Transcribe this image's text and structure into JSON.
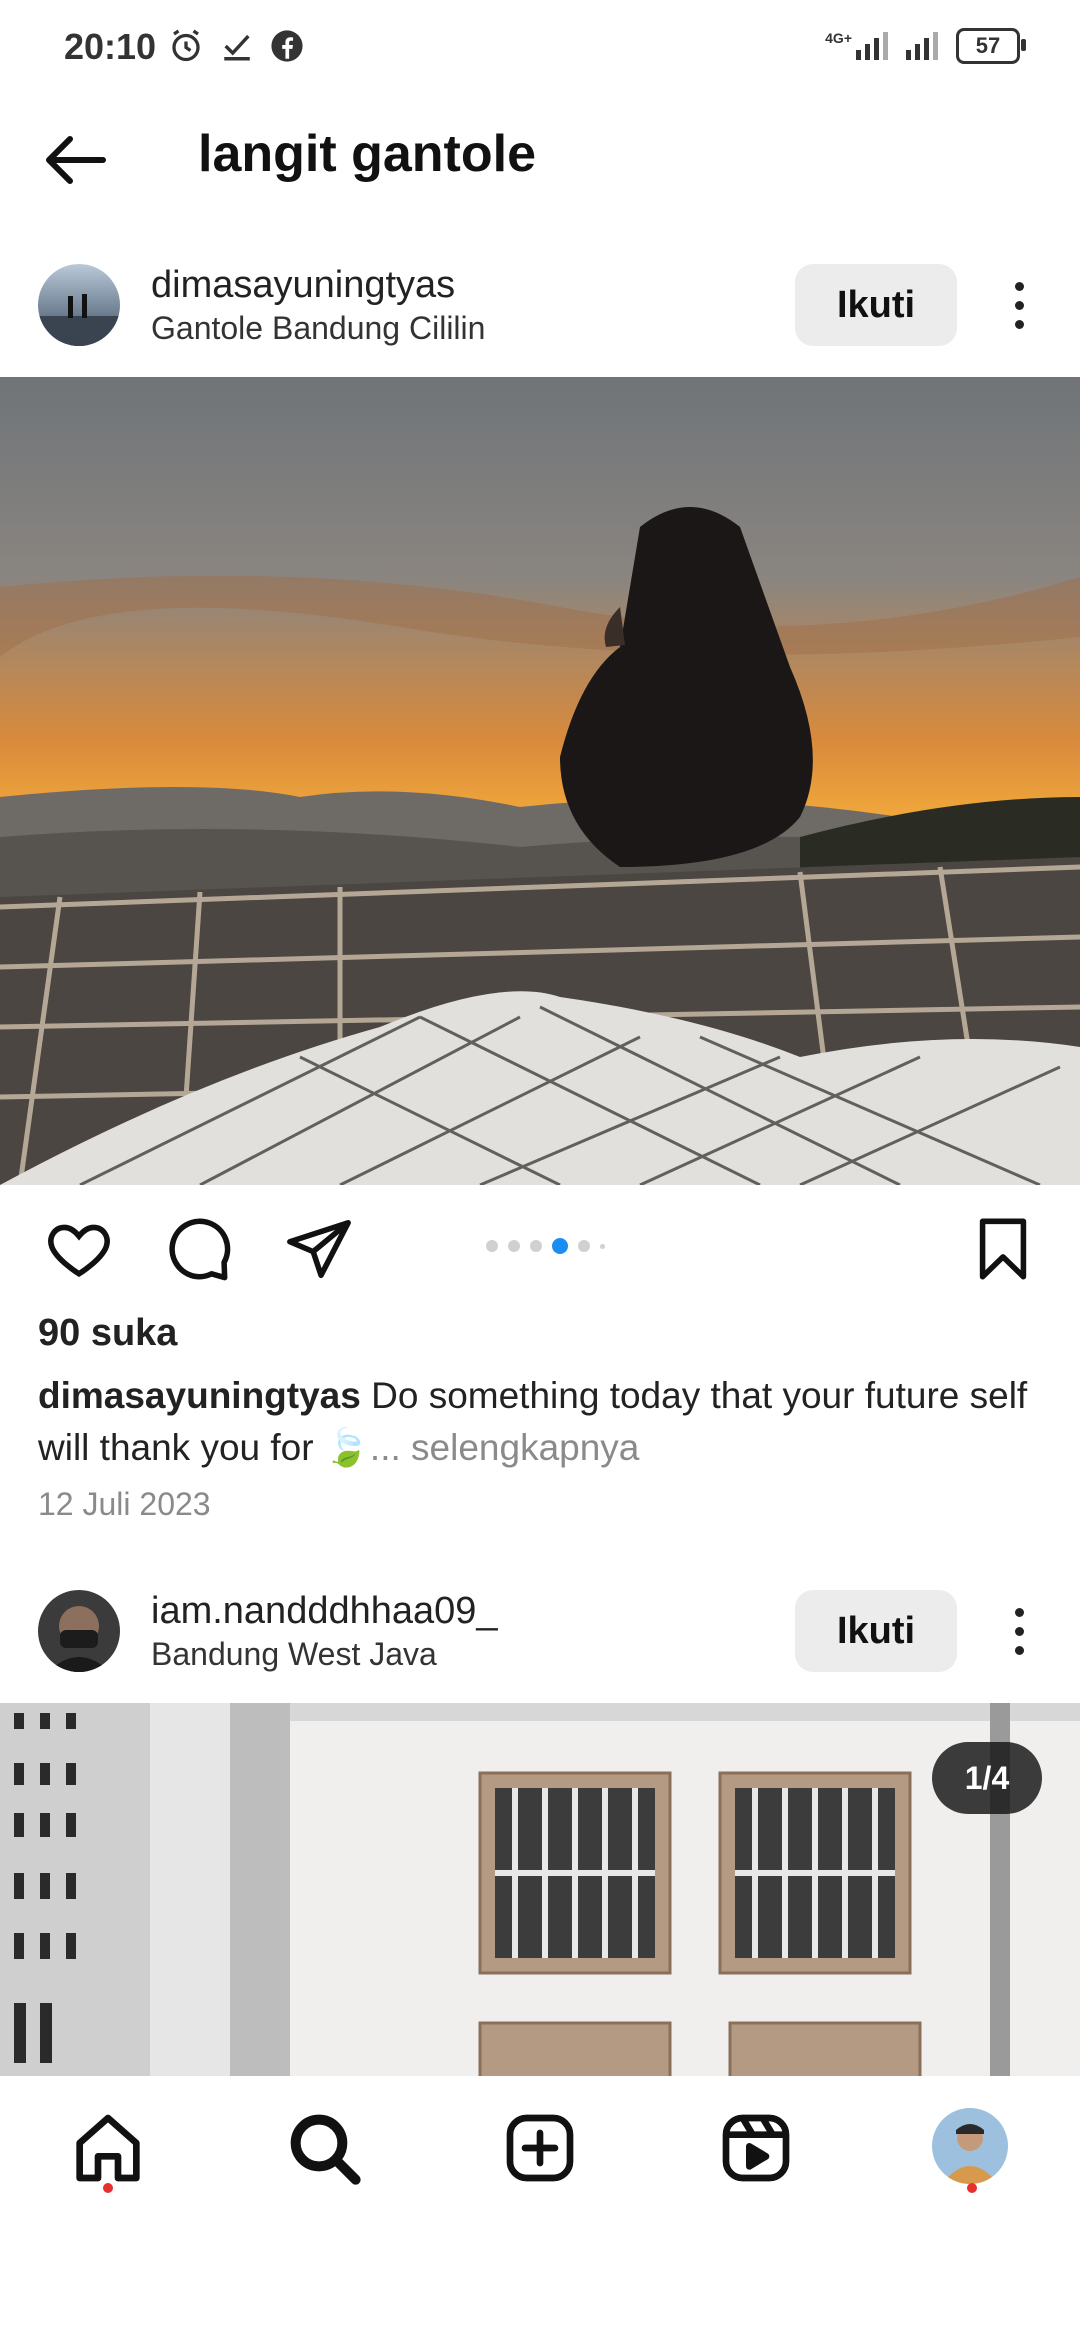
{
  "status_bar": {
    "time": "20:10",
    "icons": [
      "alarm-icon",
      "download-check-icon",
      "facebook-icon"
    ],
    "network": "4G+",
    "battery": "57"
  },
  "header": {
    "title": "langit gantole"
  },
  "posts": [
    {
      "username": "dimasayuningtyas",
      "location": "Gantole Bandung Cililin",
      "follow_label": "Ikuti",
      "likes": "90 suka",
      "caption_user": "dimasayuningtyas",
      "caption_text": " Do something today that your future self will thank you for 🍃",
      "caption_more": "... selengkapnya",
      "date": "12 Juli 2023",
      "carousel_active_index": 4,
      "carousel_count": 6
    },
    {
      "username": "iam.nandddhhaa09_",
      "location": "Bandung West Java",
      "follow_label": "Ikuti",
      "counter": "1/4"
    }
  ],
  "bottom_nav": [
    "home-icon",
    "search-icon",
    "create-icon",
    "reels-icon",
    "profile-avatar"
  ]
}
